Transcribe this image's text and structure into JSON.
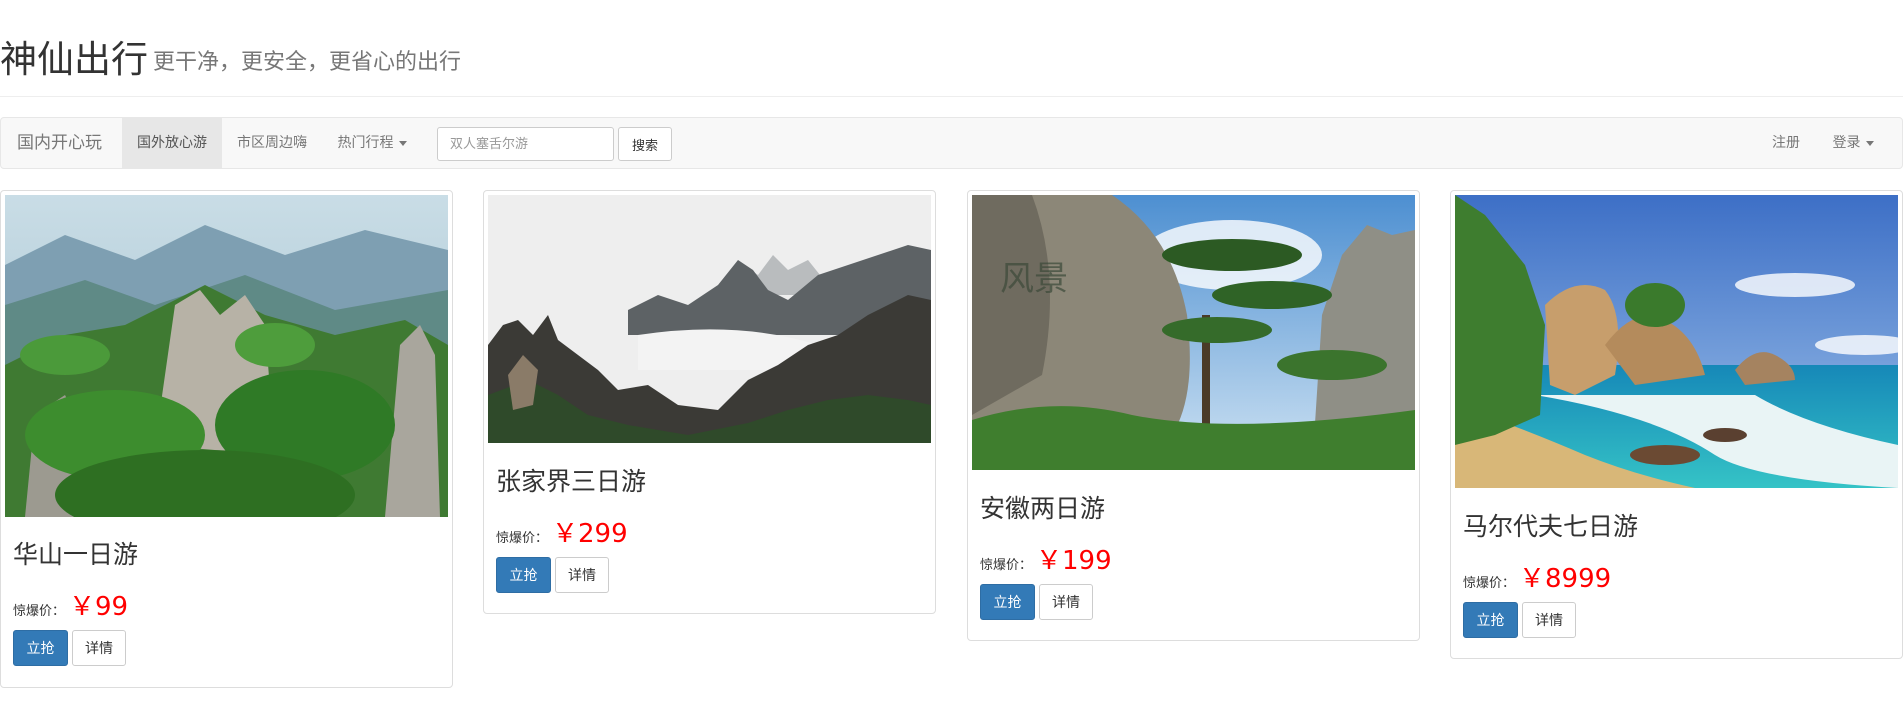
{
  "header": {
    "brand": "神仙出行",
    "slogan": "更干净，更安全，更省心的出行"
  },
  "navbar": {
    "brand": "国内开心玩",
    "items": [
      {
        "label": "国外放心游",
        "active": true
      },
      {
        "label": "市区周边嗨",
        "active": false
      },
      {
        "label": "热门行程",
        "active": false,
        "dropdown": true
      }
    ],
    "search": {
      "value": "",
      "placeholder": "双人塞舌尔游",
      "button_label": "搜索"
    },
    "right": [
      {
        "label": "注册",
        "dropdown": false
      },
      {
        "label": "登录",
        "dropdown": true
      }
    ]
  },
  "cards": [
    {
      "title": "华山一日游",
      "price_label": "惊爆价：",
      "price": "￥99",
      "buy_label": "立抢",
      "detail_label": "详情",
      "image": "mountain-forest-photo"
    },
    {
      "title": "张家界三日游",
      "price_label": "惊爆价：",
      "price": "￥299",
      "buy_label": "立抢",
      "detail_label": "详情",
      "image": "misty-peaks-photo"
    },
    {
      "title": "安徽两日游",
      "price_label": "惊爆价：",
      "price": "￥199",
      "buy_label": "立抢",
      "detail_label": "详情",
      "image": "welcome-pine-rock-photo"
    },
    {
      "title": "马尔代夫七日游",
      "price_label": "惊爆价：",
      "price": "￥8999",
      "buy_label": "立抢",
      "detail_label": "详情",
      "image": "tropical-beach-photo"
    }
  ],
  "colors": {
    "primary": "#337ab7",
    "price": "#ff0000",
    "navbar_bg": "#f8f8f8",
    "nav_active_bg": "#e7e7e7"
  }
}
